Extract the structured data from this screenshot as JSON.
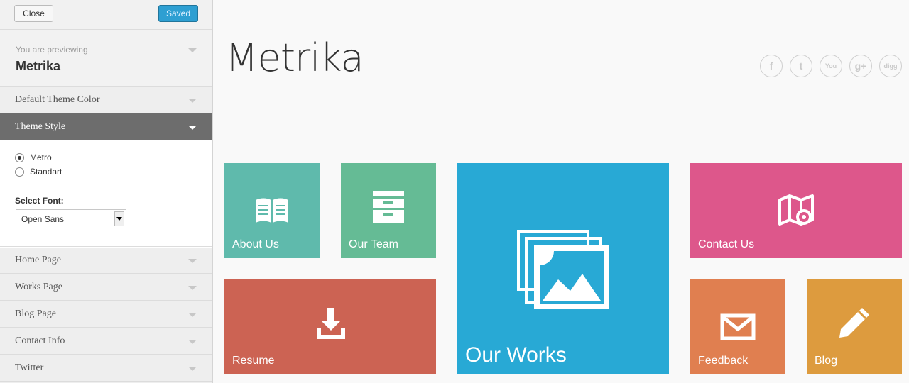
{
  "topbar": {
    "close_label": "Close",
    "saved_label": "Saved"
  },
  "preview": {
    "label": "You are previewing",
    "theme_name": "Metrika"
  },
  "sections": [
    {
      "title": "Default Theme Color",
      "open": false
    },
    {
      "title": "Theme Style",
      "open": true
    },
    {
      "title": "Home Page",
      "open": false
    },
    {
      "title": "Works Page",
      "open": false
    },
    {
      "title": "Blog Page",
      "open": false
    },
    {
      "title": "Contact Info",
      "open": false
    },
    {
      "title": "Twitter",
      "open": false
    }
  ],
  "theme_style": {
    "options": [
      {
        "label": "Metro",
        "checked": true
      },
      {
        "label": "Standart",
        "checked": false
      }
    ],
    "font_label": "Select Font:",
    "font_value": "Open Sans"
  },
  "site": {
    "title": "Metrika",
    "socials": [
      {
        "icon": "facebook-icon",
        "glyph": "f"
      },
      {
        "icon": "twitter-icon",
        "glyph": "t"
      },
      {
        "icon": "youtube-icon",
        "glyph": "You"
      },
      {
        "icon": "googleplus-icon",
        "glyph": "g+"
      },
      {
        "icon": "digg-icon",
        "glyph": "digg"
      }
    ]
  },
  "tiles": [
    {
      "label": "About Us",
      "color": "#5fbaac",
      "icon": "book-icon"
    },
    {
      "label": "Our Team",
      "color": "#65bb95",
      "icon": "cabinet-icon"
    },
    {
      "label": "Our Works",
      "color": "#28a9d5",
      "icon": "images-icon"
    },
    {
      "label": "Contact Us",
      "color": "#dd578b",
      "icon": "map-icon"
    },
    {
      "label": "Resume",
      "color": "#cc6353",
      "icon": "download-icon"
    },
    {
      "label": "Feedback",
      "color": "#e07f50",
      "icon": "envelope-icon"
    },
    {
      "label": "Blog",
      "color": "#dd9b3e",
      "icon": "pencil-icon"
    }
  ]
}
